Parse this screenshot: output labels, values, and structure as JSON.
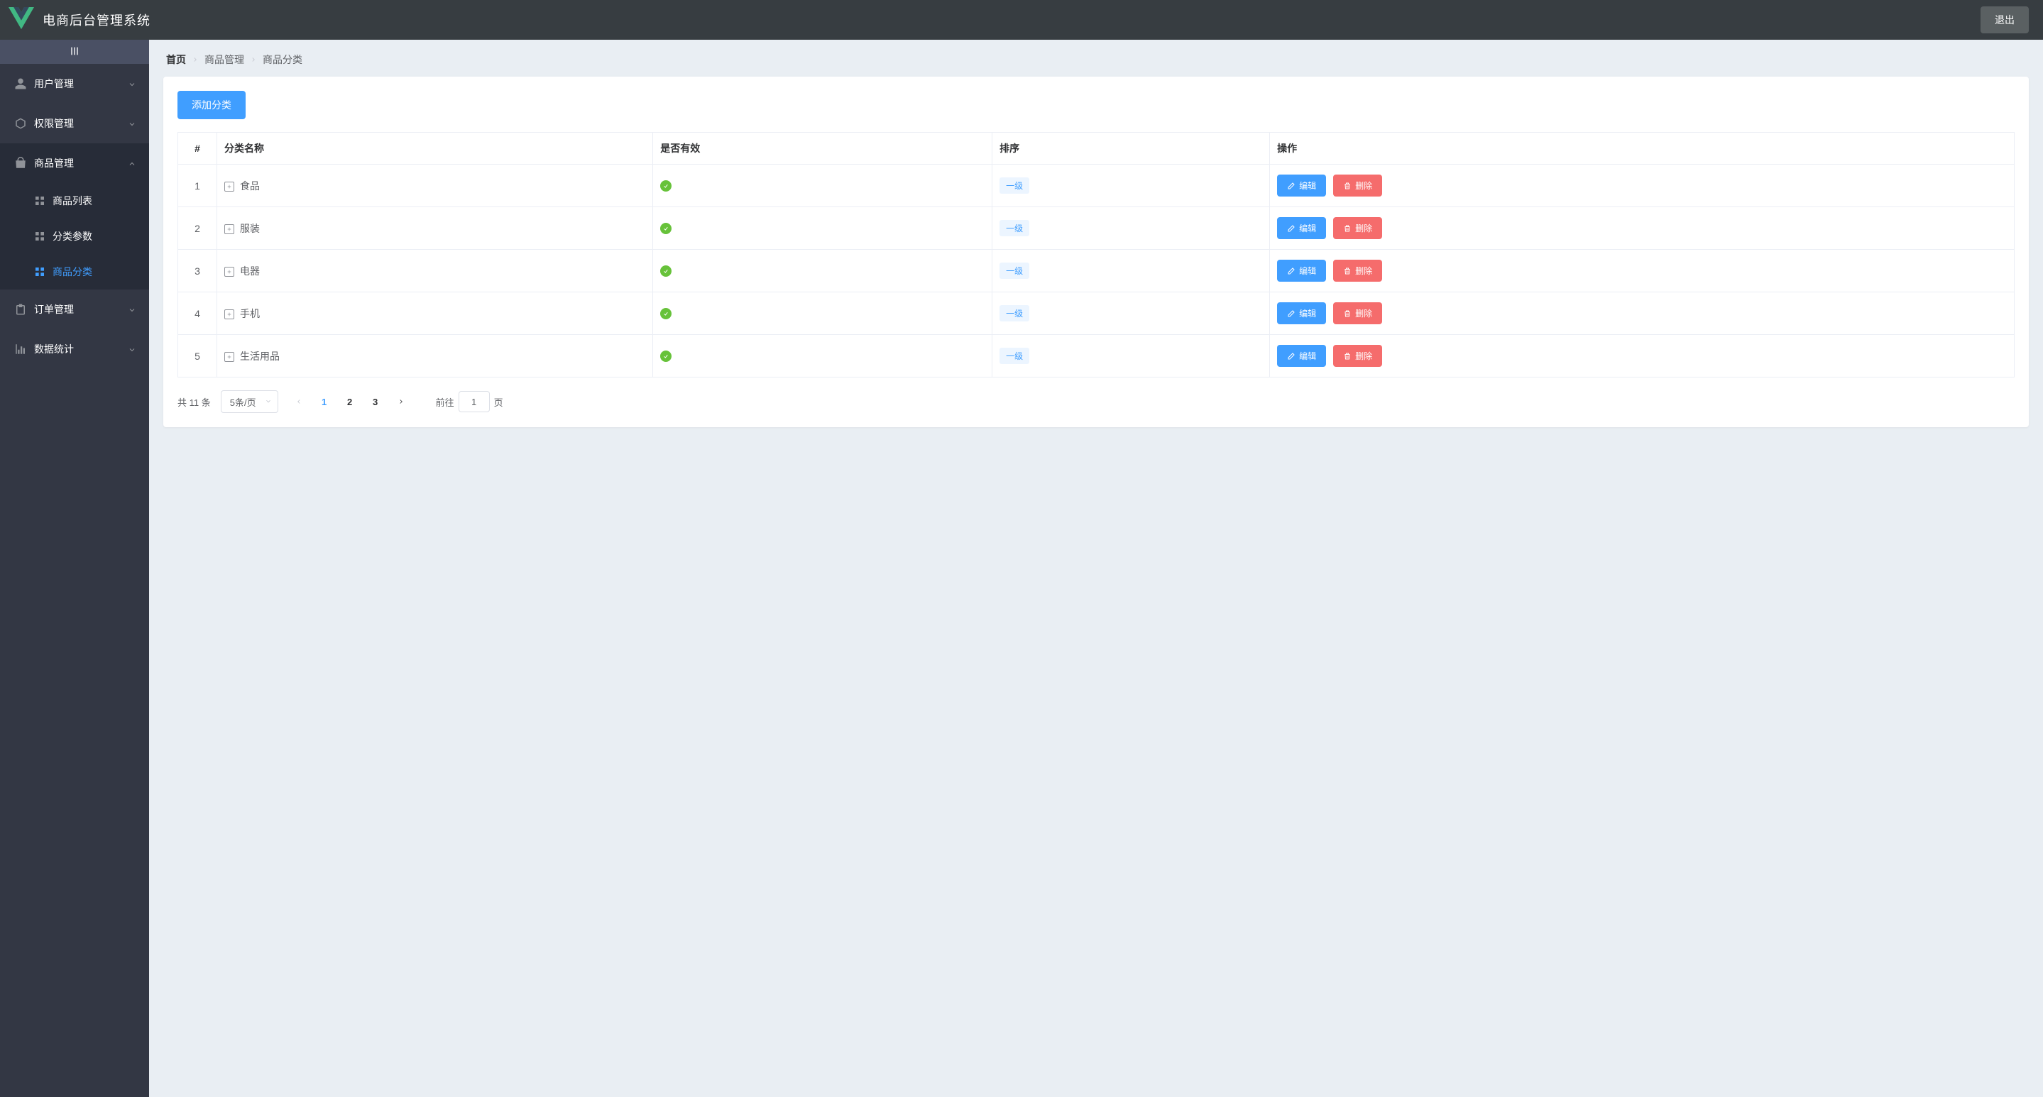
{
  "header": {
    "title": "电商后台管理系统",
    "logout_label": "退出"
  },
  "sidebar": {
    "items": [
      {
        "label": "用户管理",
        "icon": "user",
        "open": false
      },
      {
        "label": "权限管理",
        "icon": "cube",
        "open": false
      },
      {
        "label": "商品管理",
        "icon": "bag",
        "open": true,
        "children": [
          {
            "label": "商品列表",
            "active": false
          },
          {
            "label": "分类参数",
            "active": false
          },
          {
            "label": "商品分类",
            "active": true
          }
        ]
      },
      {
        "label": "订单管理",
        "icon": "clipboard",
        "open": false
      },
      {
        "label": "数据统计",
        "icon": "chart",
        "open": false
      }
    ]
  },
  "breadcrumb": {
    "home": "首页",
    "group": "商品管理",
    "page": "商品分类"
  },
  "toolbar": {
    "add_category_label": "添加分类"
  },
  "table": {
    "headers": {
      "index": "#",
      "name": "分类名称",
      "valid": "是否有效",
      "sort": "排序",
      "ops": "操作"
    },
    "level_tag": "一级",
    "edit_label": "编辑",
    "delete_label": "删除",
    "rows": [
      {
        "index": 1,
        "name": "食品",
        "valid": true
      },
      {
        "index": 2,
        "name": "服装",
        "valid": true
      },
      {
        "index": 3,
        "name": "电器",
        "valid": true
      },
      {
        "index": 4,
        "name": "手机",
        "valid": true
      },
      {
        "index": 5,
        "name": "生活用品",
        "valid": true
      }
    ]
  },
  "pagination": {
    "total_text": "共 11 条",
    "page_size_label": "5条/页",
    "pages": [
      "1",
      "2",
      "3"
    ],
    "current_page": "1",
    "jump_prefix": "前往",
    "jump_suffix": "页",
    "jump_value": "1"
  },
  "colors": {
    "primary": "#409EFF",
    "danger": "#F56C6C",
    "success": "#67C23A",
    "header_bg": "#373d41",
    "sidebar_bg": "#333744"
  }
}
